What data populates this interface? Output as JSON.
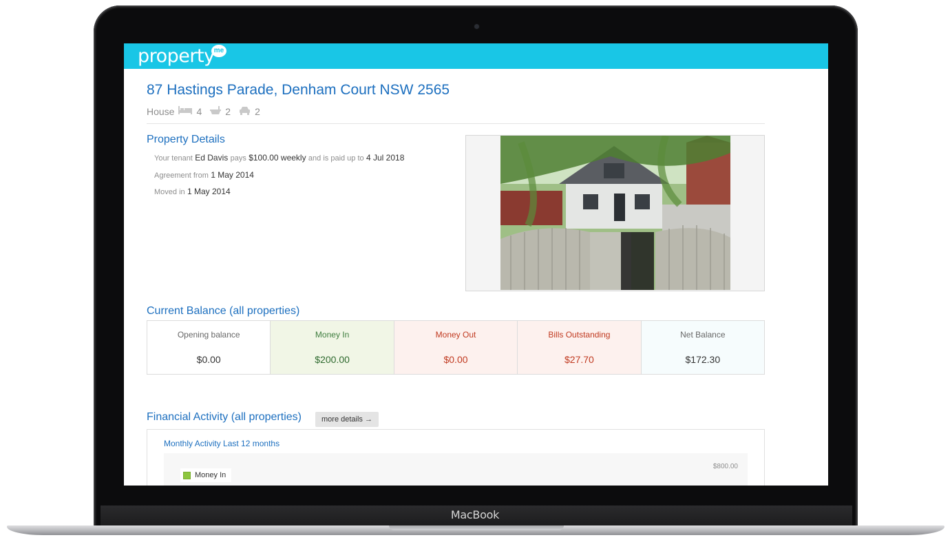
{
  "device": {
    "brand": "MacBook"
  },
  "app": {
    "logo_text": "property",
    "logo_badge": "me",
    "accent": "#19c6e6"
  },
  "property": {
    "address": "87 Hastings Parade, Denham Court NSW 2565",
    "type": "House",
    "bedrooms": "4",
    "bathrooms": "2",
    "car_spaces": "2"
  },
  "details": {
    "title": "Property Details",
    "tenant_prefix": "Your tenant",
    "tenant_name": "Ed Davis",
    "pays_text": "pays",
    "rent": "$100.00 weekly",
    "paid_up_text": "and is paid up to",
    "paid_up_date": "4 Jul 2018",
    "agreement_label": "Agreement from",
    "agreement_date": "1 May 2014",
    "moved_in_label": "Moved in",
    "moved_in_date": "1 May 2014"
  },
  "balance": {
    "title": "Current Balance (all properties)",
    "cells": [
      {
        "label": "Opening balance",
        "value": "$0.00",
        "bg": "#ffffff",
        "color": "#666666",
        "value_color": "#333333"
      },
      {
        "label": "Money In",
        "value": "$200.00",
        "bg": "#f1f6e6",
        "color": "#3e7d3e",
        "value_color": "#2f6a2f"
      },
      {
        "label": "Money Out",
        "value": "$0.00",
        "bg": "#fdf1ee",
        "color": "#c0391f",
        "value_color": "#c0391f"
      },
      {
        "label": "Bills Outstanding",
        "value": "$27.70",
        "bg": "#fdf1ee",
        "color": "#c0391f",
        "value_color": "#c0391f"
      },
      {
        "label": "Net Balance",
        "value": "$172.30",
        "bg": "#f6fcfd",
        "color": "#666666",
        "value_color": "#333333"
      }
    ]
  },
  "activity": {
    "title": "Financial Activity (all properties)",
    "more_button": "more details →",
    "subtitle": "Monthly Activity Last 12 months",
    "axis_top": "$800.00",
    "legend_money_in": "Money In"
  }
}
